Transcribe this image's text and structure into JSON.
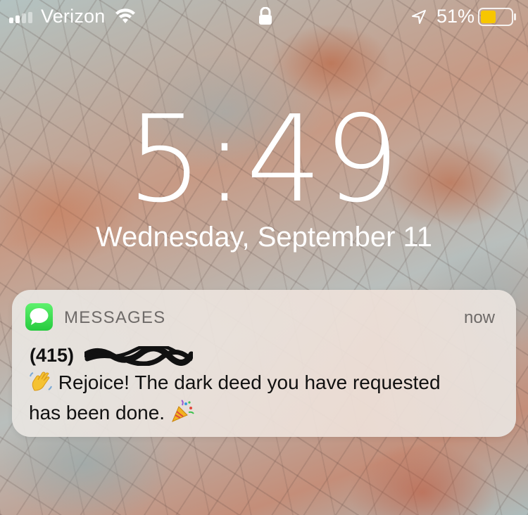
{
  "status_bar": {
    "carrier": "Verizon",
    "battery_percent": "51%",
    "battery_level": 0.51,
    "battery_color": "#f7c600",
    "icons": [
      "signal-icon",
      "wifi-icon",
      "lock-icon",
      "location-icon",
      "battery-icon"
    ]
  },
  "lock_screen": {
    "time": "5:49",
    "date": "Wednesday, September 11"
  },
  "notification": {
    "app_name": "MESSAGES",
    "app_icon": "messages-icon",
    "timestamp": "now",
    "sender": "(415)",
    "message_part1": "Rejoice! The dark deed you have requested",
    "message_part2": "has been done.",
    "emoji_start": "waving-hand-emoji",
    "emoji_end": "party-popper-emoji",
    "icon_color": "#2fd14a"
  }
}
